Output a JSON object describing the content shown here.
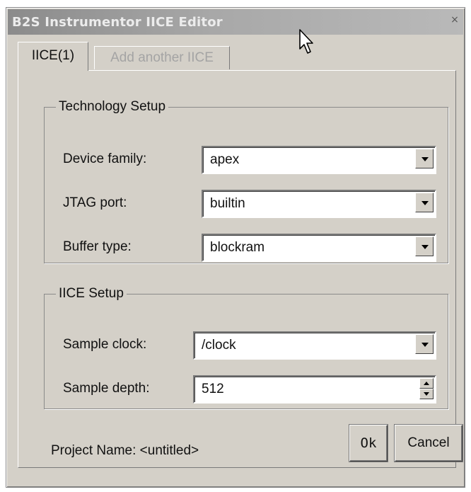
{
  "window": {
    "title": "B2S Instrumentor IICE Editor",
    "close_glyph": "×"
  },
  "tabs": [
    {
      "label": "IICE(1)",
      "active": true
    },
    {
      "label": "Add another IICE",
      "active": false
    }
  ],
  "technology_setup": {
    "legend": "Technology Setup",
    "device_family": {
      "label": "Device family:",
      "value": "apex"
    },
    "jtag_port": {
      "label": "JTAG port:",
      "value": "builtin"
    },
    "buffer_type": {
      "label": "Buffer type:",
      "value": "blockram"
    }
  },
  "iice_setup": {
    "legend": "IICE Setup",
    "sample_clock": {
      "label": "Sample clock:",
      "value": "/clock"
    },
    "sample_depth": {
      "label": "Sample depth:",
      "value": "512"
    }
  },
  "footer": {
    "project_name": "Project Name: <untitled>",
    "ok_label": "Ok",
    "cancel_label": "Cancel"
  },
  "colors": {
    "window_bg": "#d4d0c8",
    "disabled_text": "#a4a4a4",
    "title_text": "#ececec"
  }
}
